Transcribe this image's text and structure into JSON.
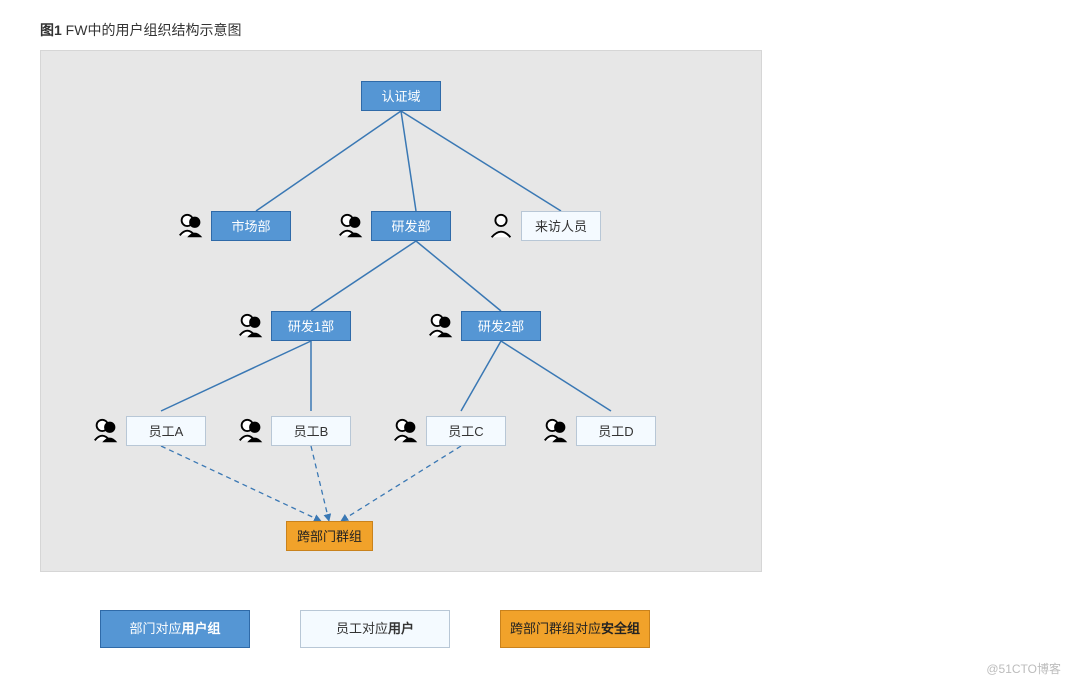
{
  "caption_prefix": "图1",
  "caption_text": " FW中的用户组织结构示意图",
  "nodes": {
    "root": {
      "label": "认证域",
      "type": "dept"
    },
    "marketing": {
      "label": "市场部",
      "type": "dept"
    },
    "rd": {
      "label": "研发部",
      "type": "dept"
    },
    "visitor": {
      "label": "来访人员",
      "type": "user"
    },
    "rd1": {
      "label": "研发1部",
      "type": "dept"
    },
    "rd2": {
      "label": "研发2部",
      "type": "dept"
    },
    "empA": {
      "label": "员工A",
      "type": "user"
    },
    "empB": {
      "label": "员工B",
      "type": "user"
    },
    "empC": {
      "label": "员工C",
      "type": "user"
    },
    "empD": {
      "label": "员工D",
      "type": "user"
    },
    "crossgrp": {
      "label": "跨部门群组",
      "type": "group"
    }
  },
  "legend": {
    "dept": {
      "pre": "部门对应",
      "bold": "用户组"
    },
    "user": {
      "pre": "员工对应",
      "bold": "用户"
    },
    "group": {
      "pre": "跨部门群组对应",
      "bold": "安全组"
    }
  },
  "watermark": "@51CTO博客",
  "chart_data": {
    "type": "tree",
    "title": "FW中的用户组织结构示意图",
    "root": "认证域",
    "edges_solid": [
      [
        "认证域",
        "市场部"
      ],
      [
        "认证域",
        "研发部"
      ],
      [
        "认证域",
        "来访人员"
      ],
      [
        "研发部",
        "研发1部"
      ],
      [
        "研发部",
        "研发2部"
      ],
      [
        "研发1部",
        "员工A"
      ],
      [
        "研发1部",
        "员工B"
      ],
      [
        "研发2部",
        "员工C"
      ],
      [
        "研发2部",
        "员工D"
      ]
    ],
    "edges_dashed": [
      [
        "员工A",
        "跨部门群组"
      ],
      [
        "员工B",
        "跨部门群组"
      ],
      [
        "员工C",
        "跨部门群组"
      ]
    ],
    "node_types": {
      "认证域": "dept",
      "市场部": "dept",
      "研发部": "dept",
      "研发1部": "dept",
      "研发2部": "dept",
      "来访人员": "user",
      "员工A": "user",
      "员工B": "user",
      "员工C": "user",
      "员工D": "user",
      "跨部门群组": "group"
    },
    "legend": {
      "dept": "部门对应用户组",
      "user": "员工对应用户",
      "group": "跨部门群组对应安全组"
    }
  }
}
